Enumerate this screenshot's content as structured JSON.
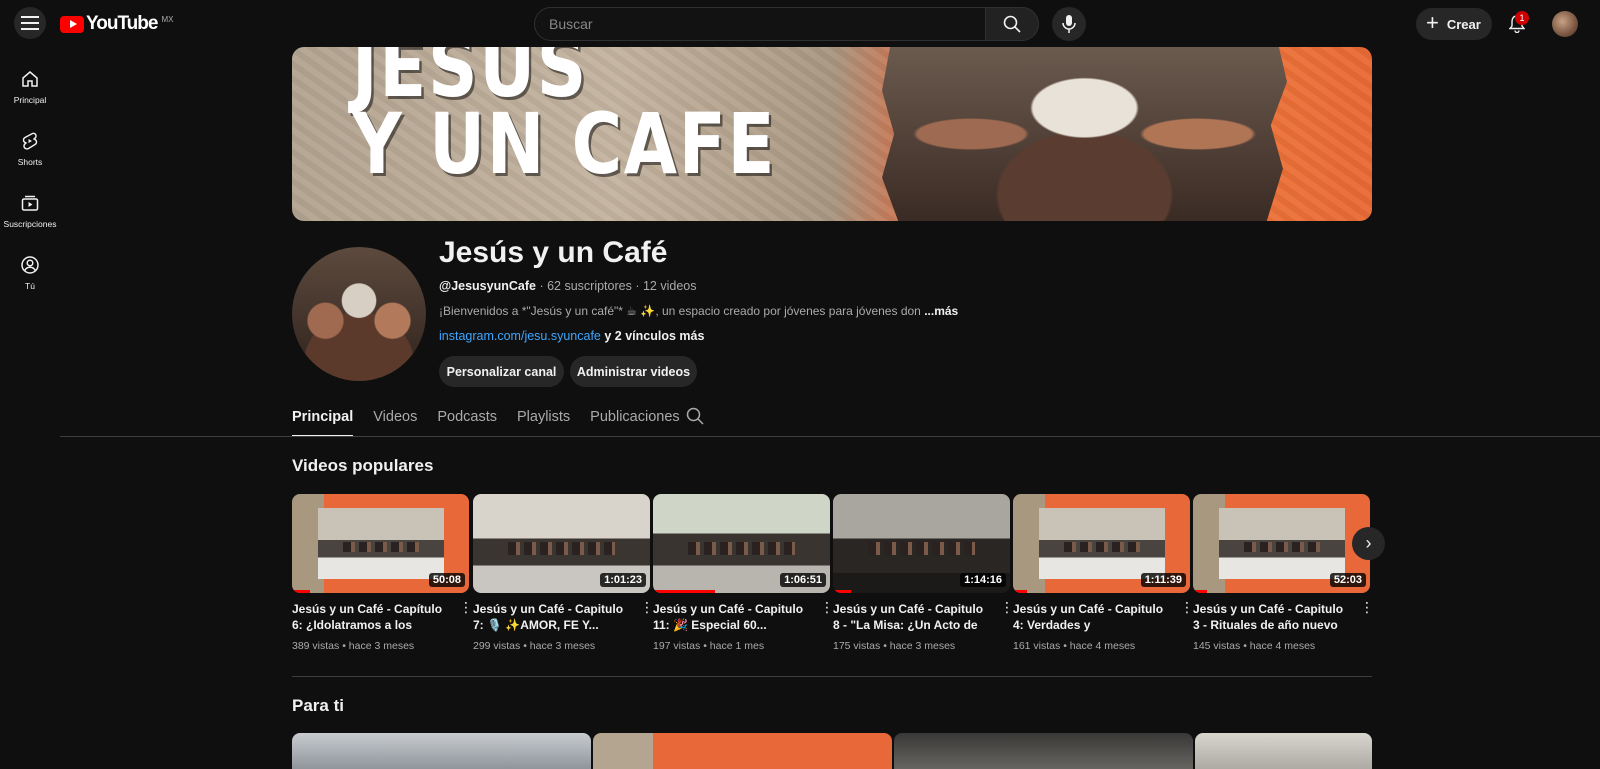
{
  "header": {
    "logo_text": "YouTube",
    "logo_country": "MX",
    "search_placeholder": "Buscar",
    "create_label": "Crear",
    "notification_count": "1"
  },
  "sidebar": {
    "items": [
      {
        "label": "Principal",
        "icon": "home-icon"
      },
      {
        "label": "Shorts",
        "icon": "shorts-icon"
      },
      {
        "label": "Suscripciones",
        "icon": "subscriptions-icon"
      },
      {
        "label": "Tú",
        "icon": "you-icon"
      }
    ]
  },
  "banner": {
    "line1": "JESÚS",
    "line2": "Y UN CAFE"
  },
  "channel": {
    "name": "Jesús y un Café",
    "handle": "@JesusyunCafe",
    "subscribers": "62 suscriptores",
    "videos_count": "12 videos",
    "description": "¡Bienvenidos a *\"Jesús y un café\"* ☕ ✨, un espacio creado por jóvenes para jóvenes don",
    "more_label": "...más",
    "link": "instagram.com/jesu.syuncafe",
    "extra_links": "y 2 vínculos más",
    "btn_customize": "Personalizar canal",
    "btn_manage": "Administrar videos"
  },
  "tabs": [
    "Principal",
    "Videos",
    "Podcasts",
    "Playlists",
    "Publicaciones"
  ],
  "sections": {
    "popular": "Videos populares",
    "for_you": "Para ti"
  },
  "videos": [
    {
      "title": "Jesús y un Café - Capítulo 6: ¿Idolatramos a los santos?",
      "duration": "50:08",
      "views": "389 vistas",
      "age": "hace 3 meses",
      "progress": 0.1
    },
    {
      "title": "Jesús y un Café - Capitulo 7: 🎙️ ✨AMOR, FE Y...",
      "duration": "1:01:23",
      "views": "299 vistas",
      "age": "hace 3 meses",
      "progress": 0.0
    },
    {
      "title": "Jesús y un Café - Capitulo 11: 🎉 Especial 60...",
      "duration": "1:06:51",
      "views": "197 vistas",
      "age": "hace 1 mes",
      "progress": 0.35
    },
    {
      "title": "Jesús y un Café - Capitulo 8 - \"La Misa: ¿Un Acto de Fe o ...",
      "duration": "1:14:16",
      "views": "175 vistas",
      "age": "hace 3 meses",
      "progress": 0.1
    },
    {
      "title": "Jesús y un Café - Capitulo 4: Verdades y charlatanerías d...",
      "duration": "1:11:39",
      "views": "161 vistas",
      "age": "hace 4 meses",
      "progress": 0.08
    },
    {
      "title": "Jesús y un Café - Capitulo 3 - Rituales de año nuevo",
      "duration": "52:03",
      "views": "145 vistas",
      "age": "hace 4 meses",
      "progress": 0.08
    }
  ]
}
